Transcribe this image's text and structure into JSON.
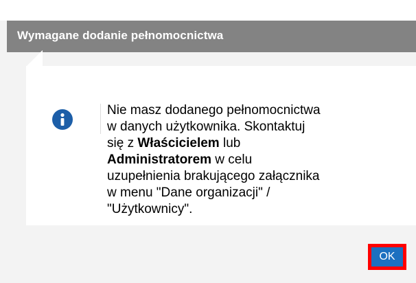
{
  "dialog": {
    "title": "Wymagane dodanie pełnomocnictwa",
    "icon": "info-icon",
    "message": {
      "line1": "Nie masz dodanego pełnomocnictwa",
      "line2": "w danych użytkownika. Skontaktuj",
      "line3_prefix": "się z ",
      "line3_bold": "Właścicielem",
      "line3_suffix": " lub",
      "line4_bold": "Administratorem",
      "line4_suffix": " w celu",
      "line5": "uzupełnienia brakującego załącznika",
      "line6": "w menu \"Dane organizacji\" /",
      "line7": "\"Użytkownicy\"."
    },
    "ok_label": "OK"
  },
  "colors": {
    "title_bar": "#838383",
    "dialog_bg": "#f3f3f3",
    "icon": "#1c5ea8",
    "button": "#1c70c0",
    "highlight": "#ff0000"
  }
}
